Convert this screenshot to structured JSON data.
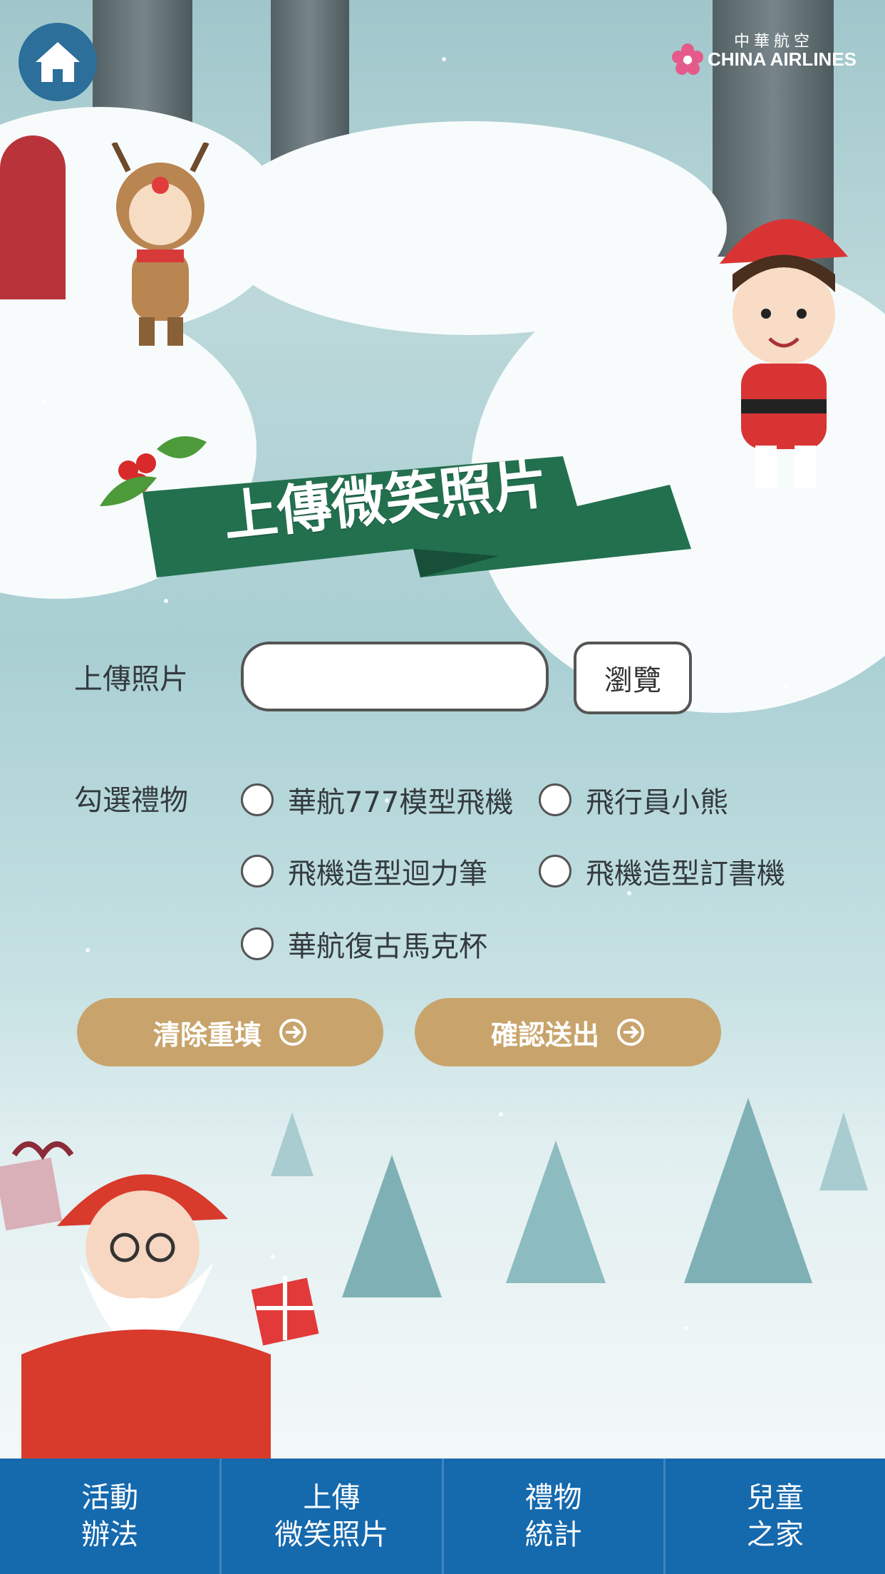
{
  "header": {
    "home_icon": "home-icon",
    "logo_zh": "中華航空",
    "logo_en": "CHINA AIRLINES"
  },
  "page_title": "上傳微笑照片",
  "upload": {
    "label": "上傳照片",
    "file_value": "",
    "browse_label": "瀏覽"
  },
  "gifts": {
    "label": "勾選禮物",
    "options": [
      "華航777模型飛機",
      "飛行員小熊",
      "飛機造型迴力筆",
      "飛機造型訂書機",
      "華航復古馬克杯"
    ]
  },
  "actions": {
    "clear_label": "清除重填",
    "submit_label": "確認送出"
  },
  "nav": [
    {
      "line1": "活動",
      "line2": "辦法"
    },
    {
      "line1": "上傳",
      "line2": "微笑照片"
    },
    {
      "line1": "禮物",
      "line2": "統計"
    },
    {
      "line1": "兒童",
      "line2": "之家"
    }
  ],
  "colors": {
    "nav_bg": "#1569ad",
    "button_gold": "#c8a46c",
    "banner_green": "#23704f"
  }
}
